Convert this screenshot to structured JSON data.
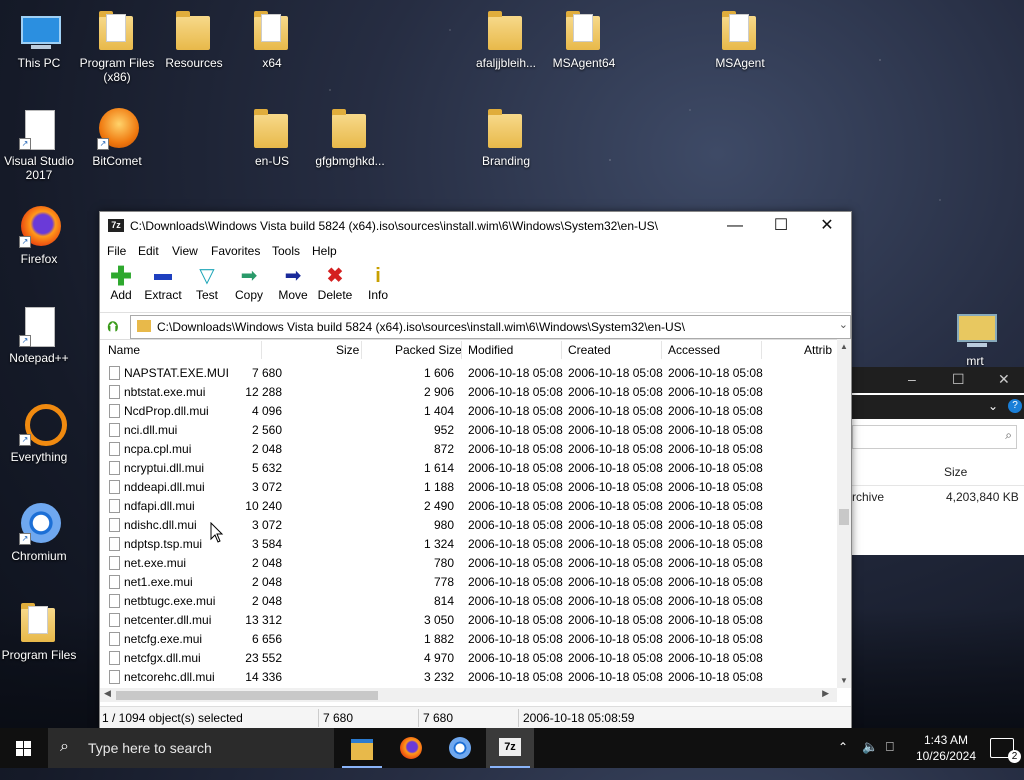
{
  "desktop": {
    "icons": [
      {
        "label": "This PC"
      },
      {
        "label": "Program Files (x86)"
      },
      {
        "label": "Resources"
      },
      {
        "label": "x64"
      },
      {
        "label": "afaljjbleih..."
      },
      {
        "label": "MSAgent64"
      },
      {
        "label": "MSAgent"
      },
      {
        "label": "Visual Studio 2017"
      },
      {
        "label": "BitComet"
      },
      {
        "label": "en-US"
      },
      {
        "label": "gfgbmghkd..."
      },
      {
        "label": "Branding"
      },
      {
        "label": "Firefox"
      },
      {
        "label": "Notepad++"
      },
      {
        "label": "Everything"
      },
      {
        "label": "Chromium"
      },
      {
        "label": "Program Files"
      },
      {
        "label": "mrt"
      }
    ]
  },
  "bgwindow": {
    "col_size": "Size",
    "row_name": "rchive",
    "row_size": "4,203,840 KB"
  },
  "window": {
    "title": "C:\\Downloads\\Windows Vista build 5824 (x64).iso\\sources\\install.wim\\6\\Windows\\System32\\en-US\\",
    "app_icon": "7z",
    "menu": [
      "File",
      "Edit",
      "View",
      "Favorites",
      "Tools",
      "Help"
    ],
    "toolbar": [
      {
        "label": "Add",
        "icon": "plus-icon",
        "color": "#2ea82e"
      },
      {
        "label": "Extract",
        "icon": "minus-icon",
        "color": "#1e3fbf"
      },
      {
        "label": "Test",
        "icon": "check-icon",
        "color": "#1fa6b8"
      },
      {
        "label": "Copy",
        "icon": "copy-arrow-icon",
        "color": "#2a9a6a"
      },
      {
        "label": "Move",
        "icon": "move-arrow-icon",
        "color": "#1a2a9a"
      },
      {
        "label": "Delete",
        "icon": "delete-x-icon",
        "color": "#d42020"
      },
      {
        "label": "Info",
        "icon": "info-icon",
        "color": "#c8a000"
      }
    ],
    "address": "C:\\Downloads\\Windows Vista build 5824 (x64).iso\\sources\\install.wim\\6\\Windows\\System32\\en-US\\",
    "columns": {
      "name": "Name",
      "size": "Size",
      "packed": "Packed Size",
      "modified": "Modified",
      "created": "Created",
      "accessed": "Accessed",
      "attrib": "Attrib"
    },
    "rows": [
      {
        "name": "NAPSTAT.EXE.MUI",
        "size": "7 680",
        "packed": "1 606",
        "modified": "2006-10-18 05:08",
        "created": "2006-10-18 05:08",
        "accessed": "2006-10-18 05:08"
      },
      {
        "name": "nbtstat.exe.mui",
        "size": "12 288",
        "packed": "2 906",
        "modified": "2006-10-18 05:08",
        "created": "2006-10-18 05:08",
        "accessed": "2006-10-18 05:08"
      },
      {
        "name": "NcdProp.dll.mui",
        "size": "4 096",
        "packed": "1 404",
        "modified": "2006-10-18 05:08",
        "created": "2006-10-18 05:08",
        "accessed": "2006-10-18 05:08"
      },
      {
        "name": "nci.dll.mui",
        "size": "2 560",
        "packed": "952",
        "modified": "2006-10-18 05:08",
        "created": "2006-10-18 05:08",
        "accessed": "2006-10-18 05:08"
      },
      {
        "name": "ncpa.cpl.mui",
        "size": "2 048",
        "packed": "872",
        "modified": "2006-10-18 05:08",
        "created": "2006-10-18 05:08",
        "accessed": "2006-10-18 05:08"
      },
      {
        "name": "ncryptui.dll.mui",
        "size": "5 632",
        "packed": "1 614",
        "modified": "2006-10-18 05:08",
        "created": "2006-10-18 05:08",
        "accessed": "2006-10-18 05:08"
      },
      {
        "name": "nddeapi.dll.mui",
        "size": "3 072",
        "packed": "1 188",
        "modified": "2006-10-18 05:08",
        "created": "2006-10-18 05:08",
        "accessed": "2006-10-18 05:08"
      },
      {
        "name": "ndfapi.dll.mui",
        "size": "10 240",
        "packed": "2 490",
        "modified": "2006-10-18 05:08",
        "created": "2006-10-18 05:08",
        "accessed": "2006-10-18 05:08"
      },
      {
        "name": "ndishc.dll.mui",
        "size": "3 072",
        "packed": "980",
        "modified": "2006-10-18 05:08",
        "created": "2006-10-18 05:08",
        "accessed": "2006-10-18 05:08"
      },
      {
        "name": "ndptsp.tsp.mui",
        "size": "3 584",
        "packed": "1 324",
        "modified": "2006-10-18 05:08",
        "created": "2006-10-18 05:08",
        "accessed": "2006-10-18 05:08"
      },
      {
        "name": "net.exe.mui",
        "size": "2 048",
        "packed": "780",
        "modified": "2006-10-18 05:08",
        "created": "2006-10-18 05:08",
        "accessed": "2006-10-18 05:08"
      },
      {
        "name": "net1.exe.mui",
        "size": "2 048",
        "packed": "778",
        "modified": "2006-10-18 05:08",
        "created": "2006-10-18 05:08",
        "accessed": "2006-10-18 05:08"
      },
      {
        "name": "netbtugc.exe.mui",
        "size": "2 048",
        "packed": "814",
        "modified": "2006-10-18 05:08",
        "created": "2006-10-18 05:08",
        "accessed": "2006-10-18 05:08"
      },
      {
        "name": "netcenter.dll.mui",
        "size": "13 312",
        "packed": "3 050",
        "modified": "2006-10-18 05:08",
        "created": "2006-10-18 05:08",
        "accessed": "2006-10-18 05:08"
      },
      {
        "name": "netcfg.exe.mui",
        "size": "6 656",
        "packed": "1 882",
        "modified": "2006-10-18 05:08",
        "created": "2006-10-18 05:08",
        "accessed": "2006-10-18 05:08"
      },
      {
        "name": "netcfgx.dll.mui",
        "size": "23 552",
        "packed": "4 970",
        "modified": "2006-10-18 05:08",
        "created": "2006-10-18 05:08",
        "accessed": "2006-10-18 05:08"
      },
      {
        "name": "netcorehc.dll.mui",
        "size": "14 336",
        "packed": "3 232",
        "modified": "2006-10-18 05:08",
        "created": "2006-10-18 05:08",
        "accessed": "2006-10-18 05:08"
      }
    ],
    "status": {
      "selection": "1 / 1094 object(s) selected",
      "size": "7 680",
      "packed": "7 680",
      "modified": "2006-10-18 05:08:59"
    }
  },
  "taskbar": {
    "search_placeholder": "Type here to search",
    "time": "1:43 AM",
    "date": "10/26/2024",
    "notifications": "2"
  }
}
